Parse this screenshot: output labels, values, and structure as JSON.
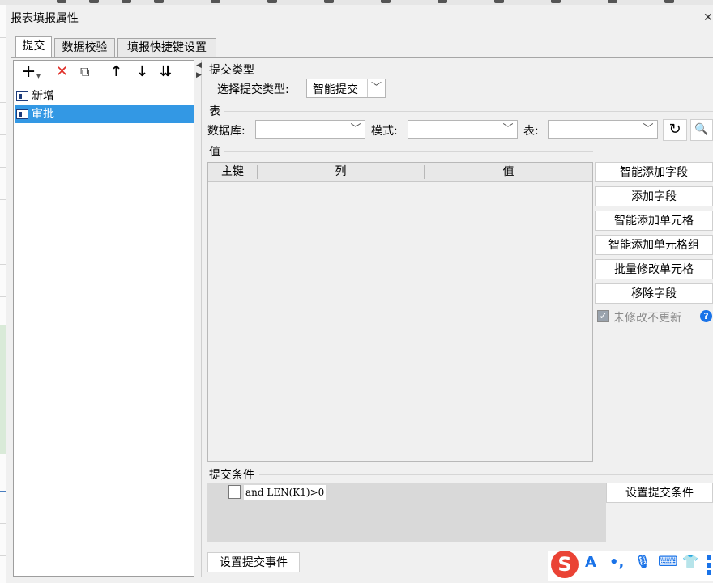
{
  "dialog": {
    "title": "报表填报属性",
    "close_icon": "close-icon"
  },
  "tabs": [
    {
      "label": "提交",
      "active": true
    },
    {
      "label": "数据校验",
      "active": false
    },
    {
      "label": "填报快捷键设置",
      "active": false
    }
  ],
  "left_toolbar": {
    "add": "+",
    "add_dropdown": "▾",
    "delete": "✕",
    "copy": "⧉",
    "up": "↑",
    "down": "↓",
    "sort": "⇊"
  },
  "submit_list": [
    {
      "label": "新增",
      "selected": false
    },
    {
      "label": "审批",
      "selected": true
    }
  ],
  "submit_type": {
    "section": "提交类型",
    "label": "选择提交类型:",
    "value": "智能提交"
  },
  "table_section": {
    "section": "表",
    "db_label": "数据库:",
    "db_value": "",
    "schema_label": "模式:",
    "schema_value": "",
    "table_label": "表:",
    "table_value": ""
  },
  "value_section": {
    "section": "值",
    "columns": [
      "主键",
      "列",
      "值"
    ],
    "rows": []
  },
  "value_buttons": {
    "smart_add_field": "智能添加字段",
    "add_field": "添加字段",
    "smart_add_cell": "智能添加单元格",
    "smart_add_cell_group": "智能添加单元格组",
    "batch_modify_cell": "批量修改单元格",
    "remove_field": "移除字段"
  },
  "no_update_unchanged": {
    "label": "未修改不更新",
    "checked": true
  },
  "submit_condition": {
    "section": "提交条件",
    "expression": "and LEN(K1)>0",
    "button": "设置提交条件"
  },
  "submit_event_button": "设置提交事件",
  "ime": {
    "a": "A",
    "punct": "•,",
    "mic": "🎙",
    "kbd": "⌨",
    "shirt": "👕"
  },
  "colors": {
    "selection": "#3398e4",
    "delete": "#e0302a",
    "help": "#1a73e8",
    "ime_logo": "#ea4335"
  }
}
